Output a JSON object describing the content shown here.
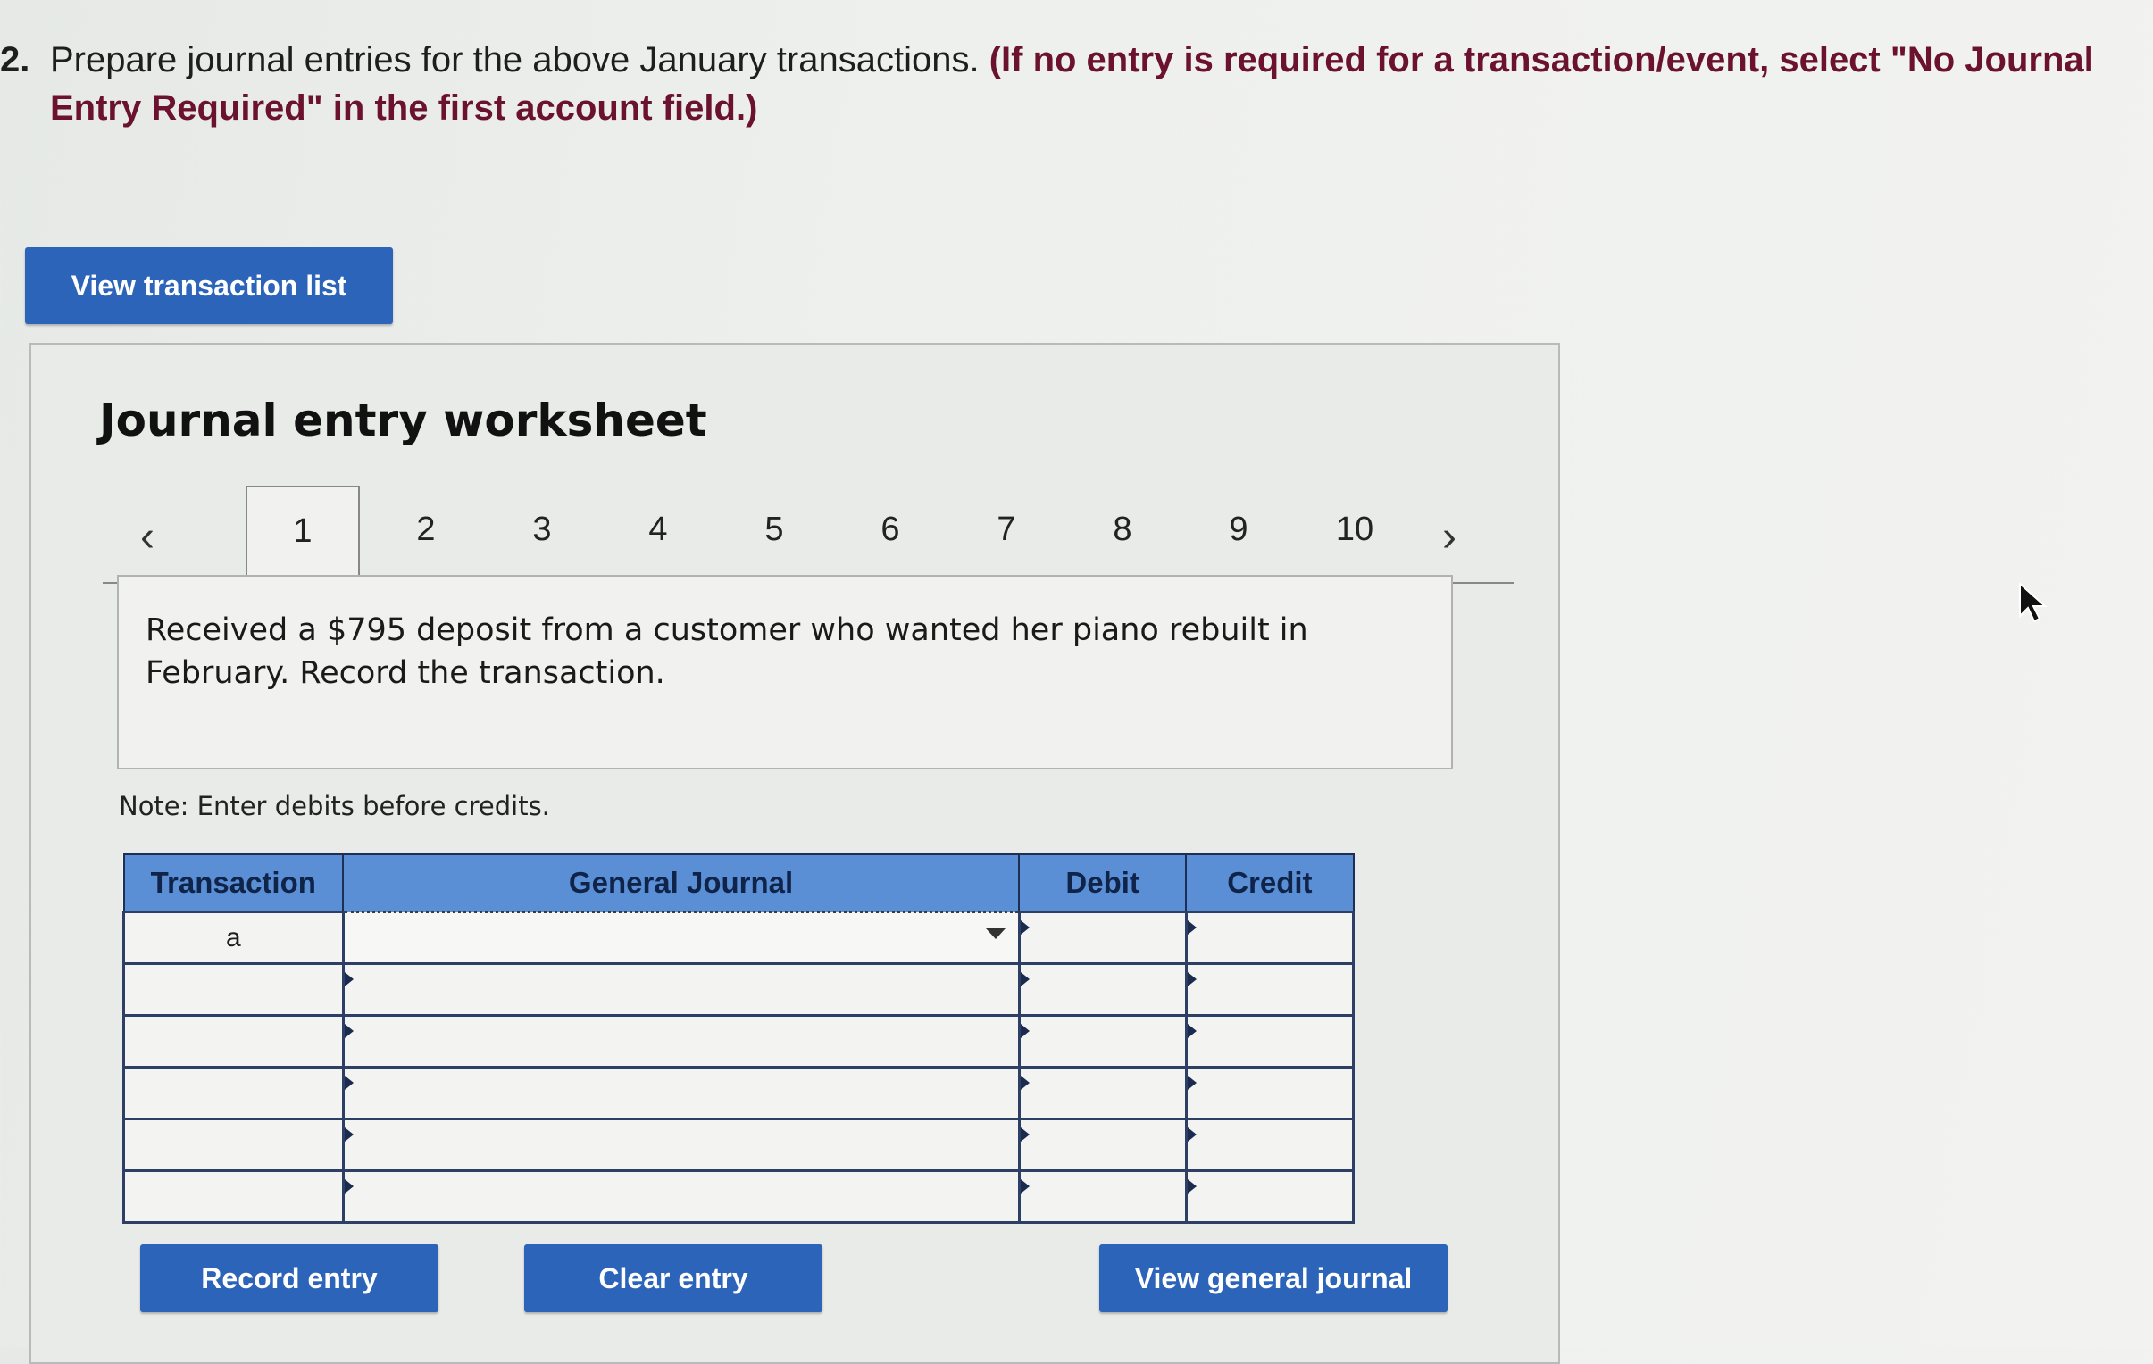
{
  "question": {
    "number": "2.",
    "text": "Prepare journal entries for the above January transactions. ",
    "emphasis": "(If no entry is required for a transaction/event, select \"No Journal Entry Required\" in the first account field.)"
  },
  "view_transaction_list_label": "View transaction list",
  "worksheet": {
    "title": "Journal entry worksheet",
    "tabs": [
      "1",
      "2",
      "3",
      "4",
      "5",
      "6",
      "7",
      "8",
      "9",
      "10"
    ],
    "active_tab": "1",
    "description": "Received a $795 deposit from a customer who wanted her piano rebuilt in February. Record the transaction.",
    "note": "Note: Enter debits before credits.",
    "table": {
      "headers": [
        "Transaction",
        "General Journal",
        "Debit",
        "Credit"
      ],
      "rows": [
        {
          "transaction": "a",
          "account": "",
          "debit": "",
          "credit": ""
        },
        {
          "transaction": "",
          "account": "",
          "debit": "",
          "credit": ""
        },
        {
          "transaction": "",
          "account": "",
          "debit": "",
          "credit": ""
        },
        {
          "transaction": "",
          "account": "",
          "debit": "",
          "credit": ""
        },
        {
          "transaction": "",
          "account": "",
          "debit": "",
          "credit": ""
        },
        {
          "transaction": "",
          "account": "",
          "debit": "",
          "credit": ""
        }
      ]
    },
    "buttons": {
      "record": "Record entry",
      "clear": "Clear entry",
      "view_general_journal": "View general journal"
    }
  },
  "colors": {
    "button_blue": "#2b64b8",
    "header_blue": "#5a8fd6",
    "emphasis_maroon": "#6b1230"
  }
}
